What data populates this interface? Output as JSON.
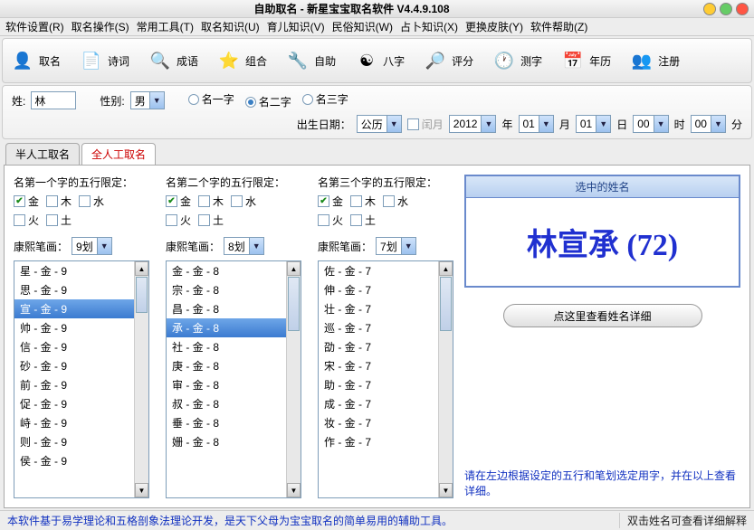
{
  "title": "自助取名 - 新星宝宝取名软件 V4.4.9.108",
  "menu": [
    "软件设置(R)",
    "取名操作(S)",
    "常用工具(T)",
    "取名知识(U)",
    "育儿知识(V)",
    "民俗知识(W)",
    "占卜知识(X)",
    "更换皮肤(Y)",
    "软件帮助(Z)"
  ],
  "toolbar": [
    {
      "label": "取名",
      "color": "#f5a623",
      "glyph": "👤"
    },
    {
      "label": "诗词",
      "color": "#f5a623",
      "glyph": "📄"
    },
    {
      "label": "成语",
      "color": "#f5a623",
      "glyph": "🔍"
    },
    {
      "label": "组合",
      "color": "#f5c518",
      "glyph": "⭐"
    },
    {
      "label": "自助",
      "color": "#888",
      "glyph": "🔧"
    },
    {
      "label": "八字",
      "color": "#e04040",
      "glyph": "☯"
    },
    {
      "label": "评分",
      "color": "#3080e0",
      "glyph": "🔎"
    },
    {
      "label": "测字",
      "color": "#60c040",
      "glyph": "🕐"
    },
    {
      "label": "年历",
      "color": "#6080c0",
      "glyph": "📅"
    },
    {
      "label": "注册",
      "color": "#f5a623",
      "glyph": "👥"
    }
  ],
  "form": {
    "surname_label": "姓:",
    "surname": "林",
    "gender_label": "性别:",
    "gender": "男",
    "name_len": [
      "名一字",
      "名二字",
      "名三字"
    ],
    "name_len_sel": 1,
    "birth_label": "出生日期：",
    "calendar": "公历",
    "leap": "闰月",
    "year": "2012",
    "year_u": "年",
    "month": "01",
    "month_u": "月",
    "day": "01",
    "day_u": "日",
    "hour": "00",
    "hour_u": "时",
    "minute": "00",
    "minute_u": "分"
  },
  "tabs": [
    "半人工取名",
    "全人工取名"
  ],
  "active_tab": 1,
  "cols": [
    {
      "title": "名第一个字的五行限定：",
      "stroke_label": "康熙笔画：",
      "stroke": "9划",
      "wuxing": [
        {
          "l": "金",
          "c": true
        },
        {
          "l": "木",
          "c": false
        },
        {
          "l": "水",
          "c": false
        },
        {
          "l": "火",
          "c": false
        },
        {
          "l": "土",
          "c": false
        }
      ],
      "items": [
        "星 - 金 - 9",
        "思 - 金 - 9",
        "宣 - 金 - 9",
        "帅 - 金 - 9",
        "信 - 金 - 9",
        "砂 - 金 - 9",
        "前 - 金 - 9",
        "促 - 金 - 9",
        "峙 - 金 - 9",
        "则 - 金 - 9",
        "侯 - 金 - 9"
      ],
      "sel": 2
    },
    {
      "title": "名第二个字的五行限定：",
      "stroke_label": "康熙笔画：",
      "stroke": "8划",
      "wuxing": [
        {
          "l": "金",
          "c": true
        },
        {
          "l": "木",
          "c": false
        },
        {
          "l": "水",
          "c": false
        },
        {
          "l": "火",
          "c": false
        },
        {
          "l": "土",
          "c": false
        }
      ],
      "items": [
        "金 - 金 - 8",
        "宗 - 金 - 8",
        "昌 - 金 - 8",
        "承 - 金 - 8",
        "社 - 金 - 8",
        "庚 - 金 - 8",
        "审 - 金 - 8",
        "叔 - 金 - 8",
        "垂 - 金 - 8",
        "姗 - 金 - 8"
      ],
      "sel": 3
    },
    {
      "title": "名第三个字的五行限定：",
      "stroke_label": "康熙笔画：",
      "stroke": "7划",
      "wuxing": [
        {
          "l": "金",
          "c": true
        },
        {
          "l": "木",
          "c": false
        },
        {
          "l": "水",
          "c": false
        },
        {
          "l": "火",
          "c": false
        },
        {
          "l": "土",
          "c": false
        }
      ],
      "items": [
        "佐 - 金 - 7",
        "伸 - 金 - 7",
        "壮 - 金 - 7",
        "巡 - 金 - 7",
        "劭 - 金 - 7",
        "宋 - 金 - 7",
        "助 - 金 - 7",
        "成 - 金 - 7",
        "妆 - 金 - 7",
        "作 - 金 - 7"
      ],
      "sel": -1
    }
  ],
  "result": {
    "head": "选中的姓名",
    "name": "林宣承 (72)"
  },
  "detail_btn": "点这里查看姓名详细",
  "hint": "请在左边根据设定的五行和笔划选定用字，并在以上查看详细。",
  "status_left": "本软件基于易学理论和五格剖象法理论开发，是天下父母为宝宝取名的简单易用的辅助工具。",
  "status_right": "双击姓名可查看详细解释"
}
